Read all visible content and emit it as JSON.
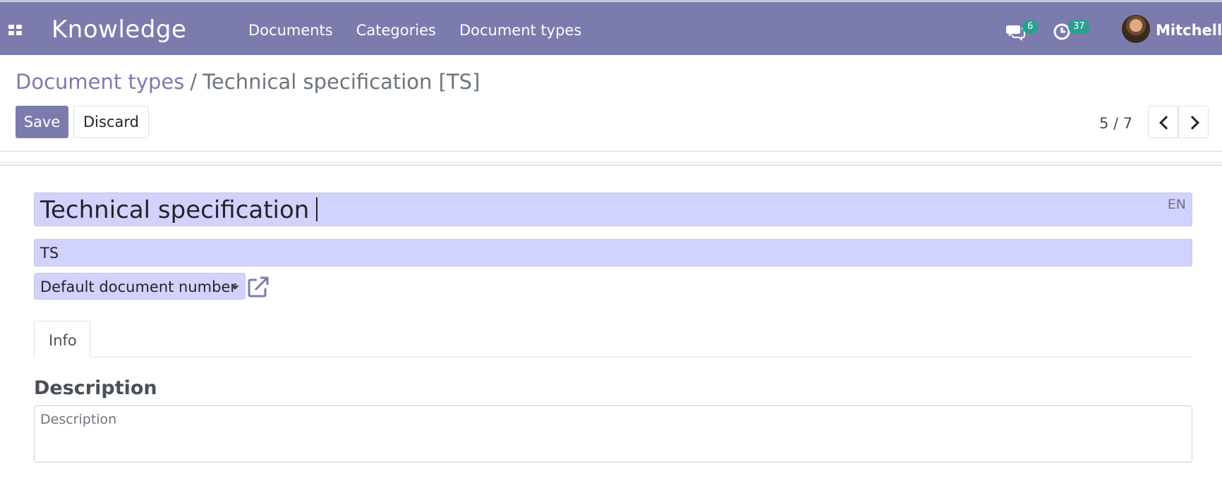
{
  "navbar": {
    "app_name": "Knowledge",
    "menu": [
      "Documents",
      "Categories",
      "Document types"
    ],
    "messages_count": "6",
    "activities_count": "37",
    "user_name": "Mitchell"
  },
  "breadcrumb": {
    "parent": "Document types",
    "separator": "/",
    "current": "Technical specification [TS]"
  },
  "toolbar": {
    "save_label": "Save",
    "discard_label": "Discard"
  },
  "pager": {
    "value": "5 / 7"
  },
  "form": {
    "name": "Technical specification",
    "lang": "EN",
    "code": "TS",
    "numbering": "Default document number",
    "tabs": [
      "Info"
    ],
    "description_label": "Description",
    "description_placeholder": "Description"
  },
  "colors": {
    "brand": "#7c7bad",
    "required_field": "#d2d2ff",
    "badge": "#28a08f"
  }
}
